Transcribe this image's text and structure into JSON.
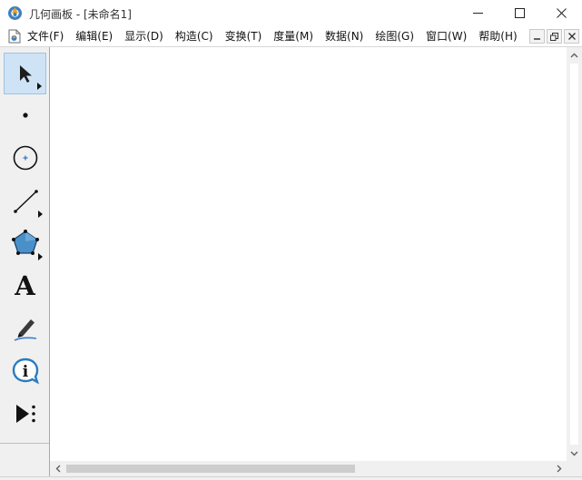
{
  "window": {
    "title": "几何画板 - [未命名1]",
    "controls": [
      "minimize",
      "maximize",
      "close"
    ]
  },
  "menubar": {
    "items": [
      {
        "label": "文件(F)"
      },
      {
        "label": "编辑(E)"
      },
      {
        "label": "显示(D)"
      },
      {
        "label": "构造(C)"
      },
      {
        "label": "变换(T)"
      },
      {
        "label": "度量(M)"
      },
      {
        "label": "数据(N)"
      },
      {
        "label": "绘图(G)"
      },
      {
        "label": "窗口(W)"
      },
      {
        "label": "帮助(H)"
      }
    ],
    "mdi_controls": [
      "minimize",
      "restore",
      "close"
    ]
  },
  "toolbox": {
    "tools": [
      {
        "name": "selection-arrow-tool",
        "icon": "arrow-cursor-icon",
        "selected": true
      },
      {
        "name": "point-tool",
        "icon": "point-icon",
        "selected": false
      },
      {
        "name": "compass-tool",
        "icon": "circle-icon",
        "selected": false
      },
      {
        "name": "straightedge-tool",
        "icon": "line-segment-icon",
        "selected": false
      },
      {
        "name": "polygon-tool",
        "icon": "pentagon-icon",
        "selected": false
      },
      {
        "name": "text-tool",
        "icon": "letter-a-icon",
        "selected": false
      },
      {
        "name": "marker-tool",
        "icon": "pen-icon",
        "selected": false
      },
      {
        "name": "information-tool",
        "icon": "info-icon",
        "selected": false
      },
      {
        "name": "custom-tool",
        "icon": "play-more-icon",
        "selected": false
      }
    ],
    "text_tool_glyph": "A",
    "info_tool_glyph": "i"
  },
  "colors": {
    "selected_tool_bg": "#cfe3f6",
    "polygon_fill": "#4a90c8",
    "info_accent": "#2b7bbf",
    "marker_line": "#3a7fd0"
  }
}
